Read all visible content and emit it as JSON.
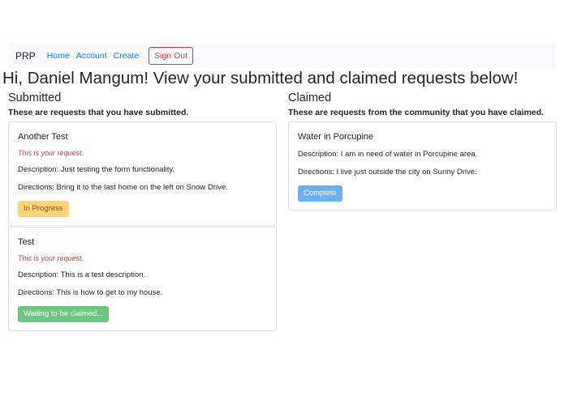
{
  "nav": {
    "brand": "PRP",
    "links": [
      "Home",
      "Account",
      "Create"
    ],
    "signout_label": "Sign Out"
  },
  "heading": "Hi, Daniel Mangum! View your submitted and claimed requests below!",
  "submitted": {
    "title": "Submitted",
    "subtitle": "These are requests that you have submitted.",
    "cards": [
      {
        "title": "Another Test",
        "note": "This is your request.",
        "description": "Description: Just testing the form functionality.",
        "directions": "Directions: Bring it to the last home on the left on Snow Drive.",
        "status": "In Progress"
      },
      {
        "title": "Test",
        "note": "This is your request.",
        "description": "Description: This is a test description.",
        "directions": "Directions: This is how to get to my house.",
        "status": "Waiting to be claimed..."
      }
    ]
  },
  "claimed": {
    "title": "Claimed",
    "subtitle": "These are requests from the community that you have claimed.",
    "cards": [
      {
        "title": "Water in Porcupine",
        "description": "Description: I am in need of water in Porcupine area.",
        "directions": "Directions: I live just outside the city on Sunny Drive.",
        "action": "Complete"
      }
    ]
  },
  "colors": {
    "link": "#007bff",
    "danger": "#dc3545",
    "warning": "#ffd37a",
    "success": "#6dc483",
    "primary": "#6ab0f5"
  }
}
